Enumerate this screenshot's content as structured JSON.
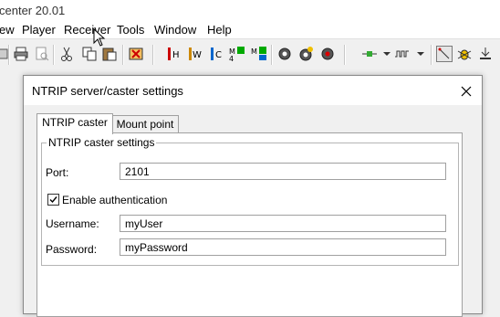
{
  "window": {
    "title": "center 20.01"
  },
  "menu": [
    "ew",
    "Player",
    "Receiver",
    "Tools",
    "Window",
    "Help"
  ],
  "toolbar": {
    "icons": [
      "print-icon",
      "print-preview-icon",
      "cut-icon",
      "copy-icon",
      "paste-icon",
      "delete-icon",
      "marker-h-icon",
      "marker-w-icon",
      "marker-c-icon",
      "add-marker-icon",
      "add-marker-alt-icon",
      "settings-gear-icon",
      "gear-star-icon",
      "gear-red-icon",
      "connection-icon",
      "waveform-icon",
      "magic-wand-icon",
      "bug-icon",
      "antenna-icon"
    ]
  },
  "dialog": {
    "title": "NTRIP server/caster settings",
    "tabs": [
      "NTRIP caster",
      "Mount point"
    ],
    "group_title": "NTRIP caster settings",
    "port_label": "Port:",
    "port_value": "2101",
    "auth_label": "Enable authentication",
    "auth_checked": true,
    "username_label": "Username:",
    "username_value": "myUser",
    "password_label": "Password:",
    "password_value": "myPassword"
  }
}
